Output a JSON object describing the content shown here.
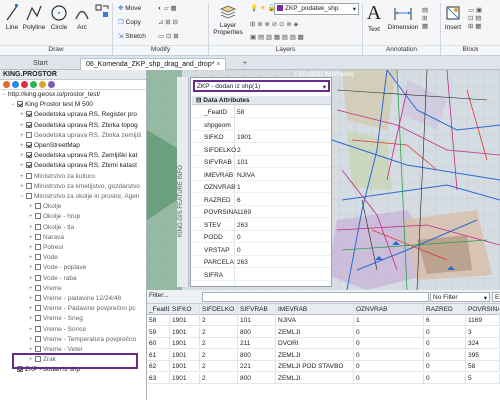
{
  "ribbon": {
    "tools": [
      {
        "label": "Line",
        "icon": "line-icon"
      },
      {
        "label": "Polyline",
        "icon": "polyline-icon"
      },
      {
        "label": "Circle",
        "icon": "circle-icon"
      },
      {
        "label": "Arc",
        "icon": "arc-icon"
      }
    ],
    "modify": [
      "Move",
      "Copy",
      "Stretch"
    ],
    "layer_properties": "Layer Properties",
    "layer_name": "ZKP_podatek_shp",
    "text": "Text",
    "dimension": "Dimension",
    "insert": "Insert",
    "groups": {
      "draw": "Draw",
      "modify": "Modify",
      "layers": "Layers",
      "annotation": "Annotation",
      "block": "Block"
    }
  },
  "tabs": [
    "Start",
    "06_Komenda_ZKP_shp_drag_and_drop*"
  ],
  "panel": {
    "title": "KING.PROSTOR",
    "items": [
      {
        "label": "http://king.geosx.io/prostor_test/",
        "indent": 0,
        "check": false,
        "expand": "−",
        "dim": false
      },
      {
        "label": "King Prostor test M 500",
        "indent": 1,
        "check": true,
        "expand": "−",
        "dim": false
      },
      {
        "label": "Geodetska uprava RS, Register pro",
        "indent": 2,
        "check": true,
        "expand": "+",
        "dim": false
      },
      {
        "label": "Geodetska uprava RS, Zbirka topog",
        "indent": 2,
        "check": true,
        "expand": "+",
        "dim": false
      },
      {
        "label": "Geodetska uprava RS, Zbirka zemljiš",
        "indent": 2,
        "check": false,
        "expand": "+",
        "dim": true
      },
      {
        "label": "OpenStreetMap",
        "indent": 2,
        "check": true,
        "expand": "+",
        "dim": false
      },
      {
        "label": "Geodetska uprava RS, Zemljiški kat",
        "indent": 2,
        "check": true,
        "expand": "+",
        "dim": false
      },
      {
        "label": "Geodetska uprava RS, Zbirni katast",
        "indent": 2,
        "check": true,
        "expand": "+",
        "dim": false
      },
      {
        "label": "Ministrstvo za kulturo",
        "indent": 2,
        "check": false,
        "expand": "+",
        "dim": true
      },
      {
        "label": "Ministrstvo za kmetijstvo, gozdarstvo",
        "indent": 2,
        "check": false,
        "expand": "+",
        "dim": true
      },
      {
        "label": "Ministrstvo za okolje in prostor, Agen",
        "indent": 2,
        "check": false,
        "expand": "−",
        "dim": true
      },
      {
        "label": "Okolje",
        "indent": 3,
        "check": false,
        "expand": "+",
        "dim": true
      },
      {
        "label": "Okolje - hrup",
        "indent": 3,
        "check": false,
        "expand": "+",
        "dim": true
      },
      {
        "label": "Okolje - tla",
        "indent": 3,
        "check": false,
        "expand": "+",
        "dim": true
      },
      {
        "label": "Narava",
        "indent": 3,
        "check": false,
        "expand": "+",
        "dim": true
      },
      {
        "label": "Potresi",
        "indent": 3,
        "check": false,
        "expand": "+",
        "dim": true
      },
      {
        "label": "Vode",
        "indent": 3,
        "check": false,
        "expand": "+",
        "dim": true
      },
      {
        "label": "Vode - poplave",
        "indent": 3,
        "check": false,
        "expand": "+",
        "dim": true
      },
      {
        "label": "Vode - raba",
        "indent": 3,
        "check": false,
        "expand": "+",
        "dim": true
      },
      {
        "label": "Vreme",
        "indent": 3,
        "check": false,
        "expand": "+",
        "dim": true
      },
      {
        "label": "Vreme - padavine 12/24/48",
        "indent": 3,
        "check": false,
        "expand": "+",
        "dim": true
      },
      {
        "label": "Vreme - Padavine povprečno pc",
        "indent": 3,
        "check": false,
        "expand": "+",
        "dim": true
      },
      {
        "label": "Vreme - Sneg",
        "indent": 3,
        "check": false,
        "expand": "+",
        "dim": true
      },
      {
        "label": "Vreme - Sonce",
        "indent": 3,
        "check": false,
        "expand": "+",
        "dim": true
      },
      {
        "label": "Vreme - Temperatura povprečno",
        "indent": 3,
        "check": false,
        "expand": "+",
        "dim": true
      },
      {
        "label": "Vreme - Veter",
        "indent": 3,
        "check": false,
        "expand": "+",
        "dim": true
      },
      {
        "label": "Zrak",
        "indent": 3,
        "check": false,
        "expand": "+",
        "dim": true
      },
      {
        "label": "ZKP - dodan iz shp",
        "indent": 1,
        "check": true,
        "expand": "",
        "dim": false
      }
    ]
  },
  "viewport_label": "[-][Top][2D Wireframe]",
  "feature_info": {
    "vertical_title": "KING.GIS FEATURE INFO",
    "selector": "ZKP - dodan iz shp(1)",
    "section": "Data Attributes",
    "rows": [
      {
        "k": "_FeatID",
        "v": "58"
      },
      {
        "k": "shpgeom",
        "v": ""
      },
      {
        "k": "SIFKO",
        "v": "1901"
      },
      {
        "k": "SIFDELKO",
        "v": "2"
      },
      {
        "k": "SIFVRAB",
        "v": "101"
      },
      {
        "k": "IMEVRAB",
        "v": "NJIVA"
      },
      {
        "k": "OZNVRAB",
        "v": "1"
      },
      {
        "k": "RAZRED",
        "v": "6"
      },
      {
        "k": "POVRSINA",
        "v": "1169"
      },
      {
        "k": "STEV",
        "v": "263"
      },
      {
        "k": "PODD",
        "v": "0"
      },
      {
        "k": "VRSTAP",
        "v": "0"
      },
      {
        "k": "PARCELA",
        "v": "263"
      },
      {
        "k": "SIFRA",
        "v": ""
      }
    ]
  },
  "filter": {
    "label": "Filter...",
    "mode": "No Filter",
    "export": "Export"
  },
  "table": {
    "headers": [
      "_FeatID",
      "SIFKO",
      "SIFDELKO",
      "SIFVRAB",
      "IMEVRAB",
      "OZNVRAB",
      "RAZRED",
      "POVRSINA"
    ],
    "rows": [
      [
        "58",
        "1901",
        "2",
        "101",
        "NJIVA",
        "1",
        "6",
        "1169"
      ],
      [
        "59",
        "1901",
        "2",
        "800",
        "ZEMLJI",
        "0",
        "0",
        "3"
      ],
      [
        "60",
        "1901",
        "2",
        "211",
        "DVORI",
        "0",
        "0",
        "324"
      ],
      [
        "61",
        "1901",
        "2",
        "800",
        "ZEMLJI",
        "0",
        "0",
        "395"
      ],
      [
        "62",
        "1901",
        "2",
        "221",
        "ZEMLJI POD STAVBO",
        "0",
        "0",
        "58"
      ],
      [
        "63",
        "1901",
        "2",
        "800",
        "ZEMLJI",
        "0",
        "0",
        "5"
      ]
    ]
  },
  "colors": {
    "accent": "#6a2a8a",
    "map_bg": "#d8dee4"
  }
}
